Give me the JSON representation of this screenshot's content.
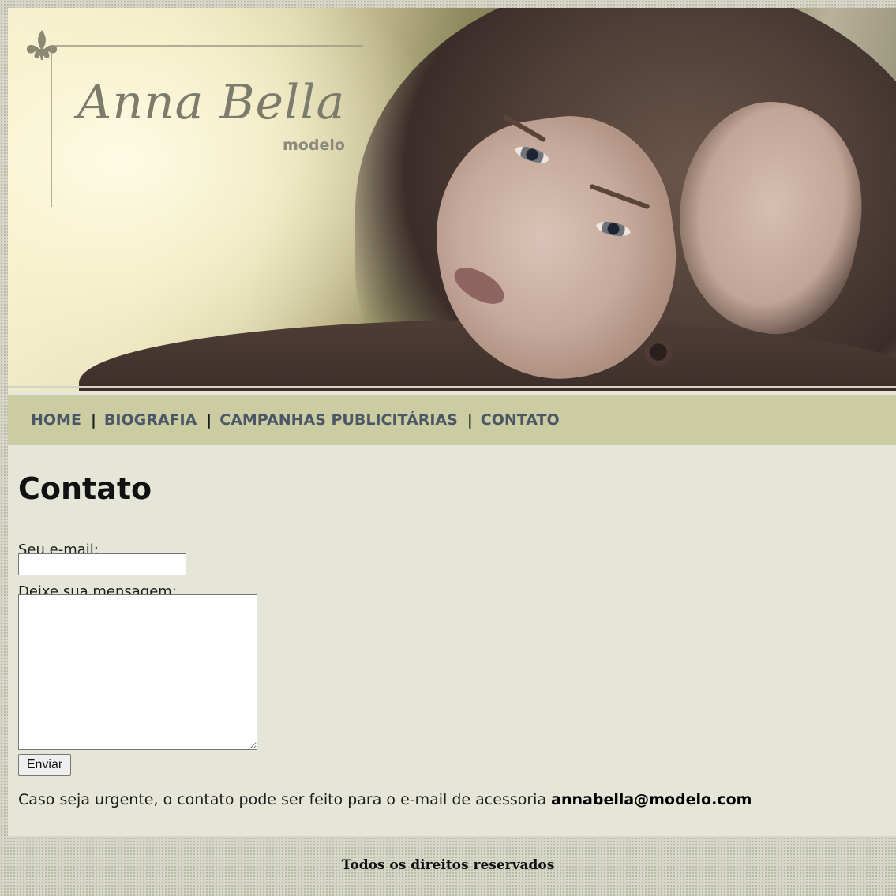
{
  "brand": {
    "name": "Anna Bella",
    "subtitle": "modelo"
  },
  "nav": {
    "items": [
      {
        "label": "HOME"
      },
      {
        "label": "BIOGRAFIA"
      },
      {
        "label": "CAMPANHAS PUBLICITÁRIAS"
      },
      {
        "label": "CONTATO"
      }
    ],
    "separator": "|"
  },
  "main": {
    "title": "Contato",
    "email_label": "Seu e-mail:",
    "email_value": "",
    "message_label": "Deixe sua mensagem:",
    "message_value": "",
    "submit_label": "Enviar",
    "urgent_text": "Caso seja urgente, o contato pode ser feito para o e-mail de acessoria",
    "urgent_email": "annabella@modelo.com"
  },
  "footer": {
    "text": "Todos os direitos reservados"
  },
  "colors": {
    "nav_bg": "#cbcca1",
    "nav_link": "#4b5766",
    "content_bg": "#e6e6d8",
    "page_bg": "#d6d7c6"
  },
  "icons": {
    "logo_ornament": "fleur-de-lis-icon"
  }
}
